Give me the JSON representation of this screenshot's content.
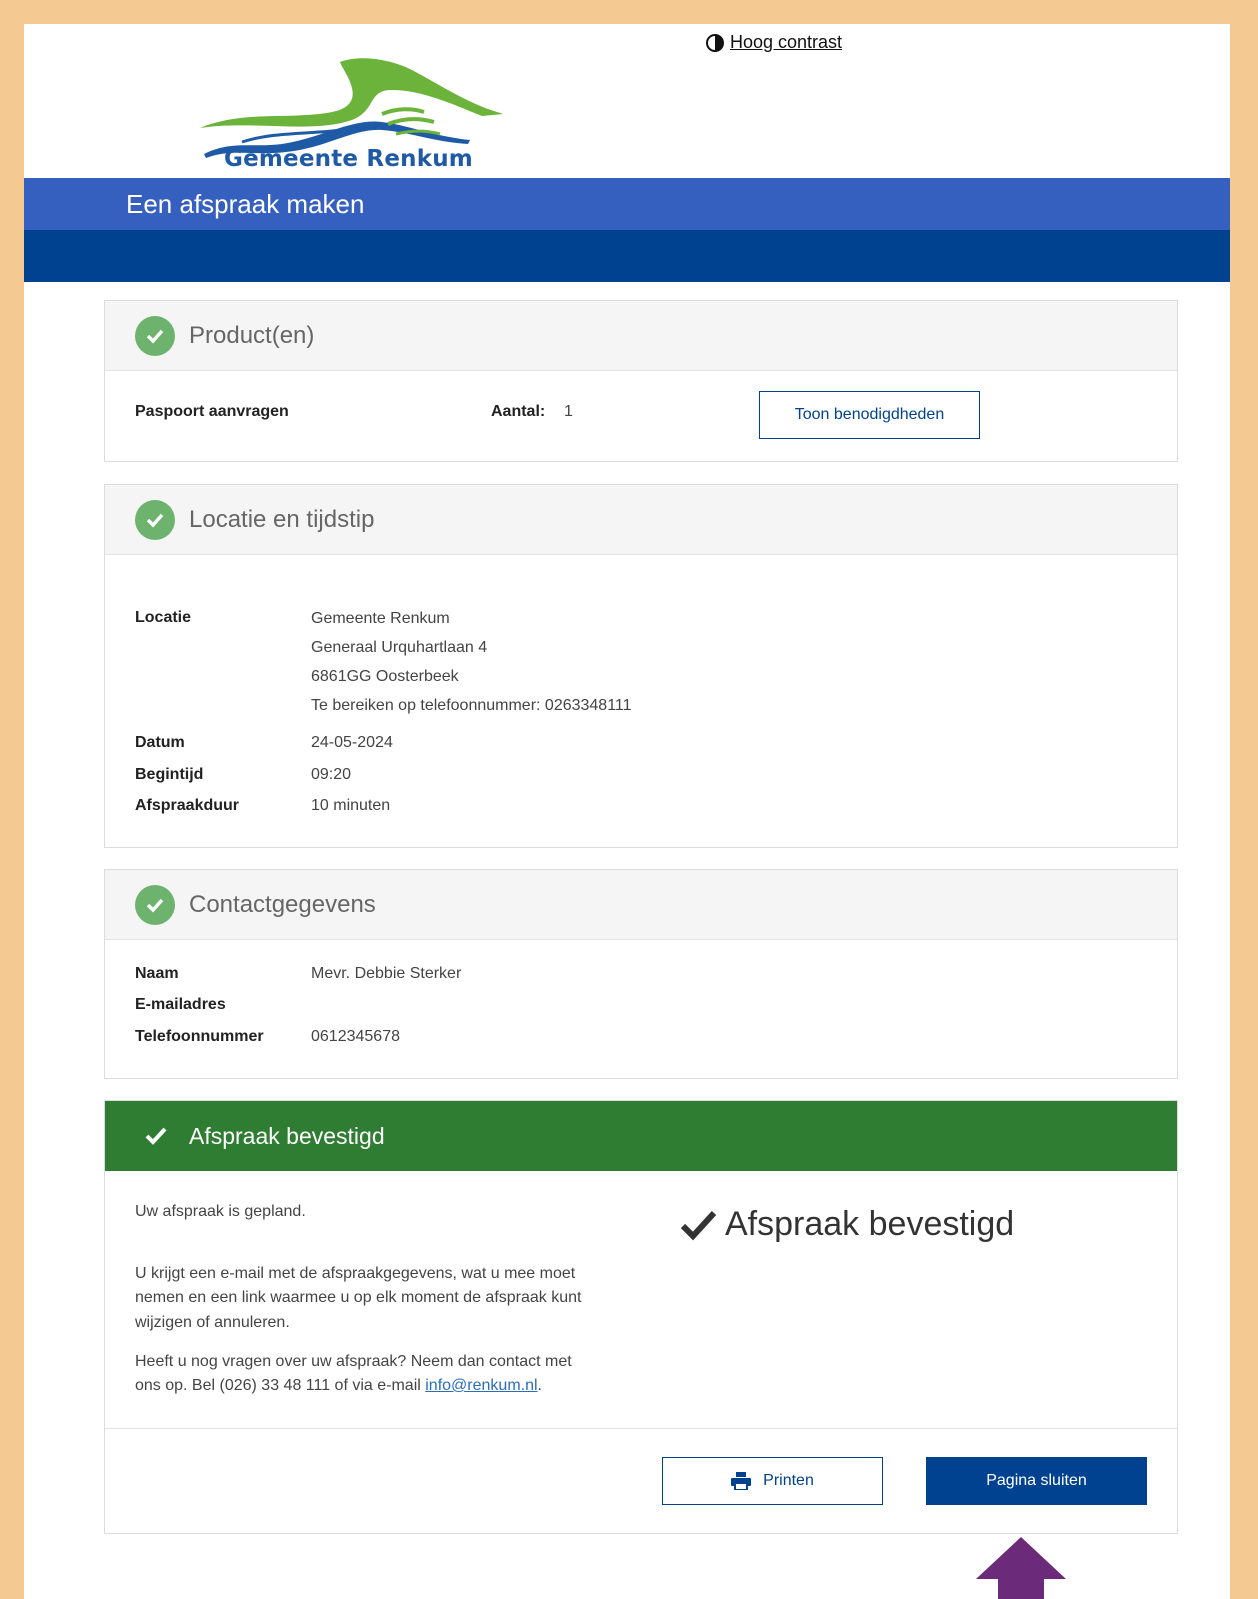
{
  "header": {
    "logo_text": "Gemeente Renkum",
    "contrast_link": "Hoog contrast",
    "banner_title": "Een afspraak maken"
  },
  "products": {
    "title": "Product(en)",
    "product_name": "Paspoort aanvragen",
    "quantity_label": "Aantal:",
    "quantity_value": "1",
    "requirements_button": "Toon benodigdheden"
  },
  "location": {
    "title": "Locatie en tijdstip",
    "location_label": "Locatie",
    "address_lines": [
      "Gemeente Renkum",
      "Generaal Urquhartlaan 4",
      "6861GG Oosterbeek",
      "Te bereiken op telefoonnummer: 0263348111"
    ],
    "date_label": "Datum",
    "date_value": "24-05-2024",
    "start_label": "Begintijd",
    "start_value": "09:20",
    "duration_label": "Afspraakduur",
    "duration_value": "10 minuten"
  },
  "contact": {
    "title": "Contactgegevens",
    "name_label": "Naam",
    "name_value": "Mevr. Debbie Sterker",
    "email_label": "E-mailadres",
    "email_value": "",
    "phone_label": "Telefoonnummer",
    "phone_value": "0612345678"
  },
  "confirmation": {
    "title": "Afspraak bevestigd",
    "big_title": "Afspraak bevestigd",
    "planned_text": "Uw afspraak is gepland.",
    "email_text_line1": "U krijgt een e-mail met de afspraakgegevens, wat u mee moet",
    "email_text_line2": "nemen en een link waarmee u op elk moment de afspraak kunt",
    "email_text_line3": "wijzigen of annuleren.",
    "questions_line1": "Heeft u nog vragen over uw afspraak? Neem dan contact met",
    "questions_line2": "ons op. Bel (026) 33 48 111 of via e-mail",
    "email_link": "info@renkum.nl",
    "period": ".",
    "print_button": "Printen",
    "close_button": "Pagina sluiten"
  },
  "colors": {
    "frame": "#f5c992",
    "banner": "#3660c0",
    "navband": "#00428f",
    "success": "#2e7d32",
    "check": "#6db36d",
    "arrow": "#6b2a7a"
  }
}
